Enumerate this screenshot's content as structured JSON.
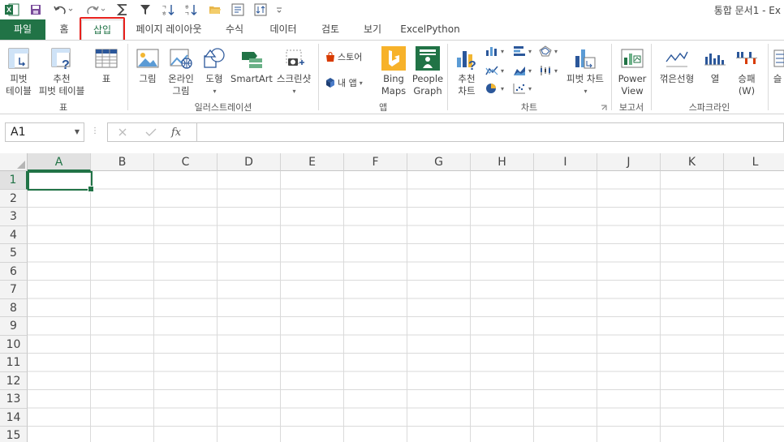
{
  "window": {
    "title": "통합 문서1 - Ex"
  },
  "tabs": [
    {
      "label": "파일"
    },
    {
      "label": "홈"
    },
    {
      "label": "삽입"
    },
    {
      "label": "페이지 레이아웃"
    },
    {
      "label": "수식"
    },
    {
      "label": "데이터"
    },
    {
      "label": "검토"
    },
    {
      "label": "보기"
    },
    {
      "label": "ExcelPython"
    }
  ],
  "ribbon": {
    "tables": {
      "pivot": "피벗\n테이블",
      "pivot_l1": "피벗",
      "pivot_l2": "테이블",
      "rec_l1": "추천",
      "rec_l2": "피벗 테이블",
      "table": "표",
      "group": "표"
    },
    "illustrations": {
      "picture": "그림",
      "online_l1": "온라인",
      "online_l2": "그림",
      "shapes": "도형",
      "smartart": "SmartArt",
      "screenshot": "스크린샷",
      "group": "일러스트레이션"
    },
    "apps": {
      "store": "스토어",
      "myapps": "내 앱",
      "bing_l1": "Bing",
      "bing_l2": "Maps",
      "people_l1": "People",
      "people_l2": "Graph",
      "group": "앱"
    },
    "charts": {
      "rec_l1": "추천",
      "rec_l2": "차트",
      "pivotchart": "피벗 차트",
      "group": "차트"
    },
    "reports": {
      "power_l1": "Power",
      "power_l2": "View",
      "group": "보고서"
    },
    "sparklines": {
      "line": "꺾은선형",
      "column": "열",
      "winloss_l1": "승패",
      "winloss_l2": "(W)",
      "group": "스파크라인"
    },
    "slicer": "슬"
  },
  "formula_bar": {
    "name_box": "A1",
    "fx": "fx",
    "value": ""
  },
  "grid": {
    "columns": [
      "A",
      "B",
      "C",
      "D",
      "E",
      "F",
      "G",
      "H",
      "I",
      "J",
      "K",
      "L"
    ],
    "rows": [
      "1",
      "2",
      "3",
      "4",
      "5",
      "6",
      "7",
      "8",
      "9",
      "10",
      "11",
      "12",
      "13",
      "14",
      "15"
    ],
    "active_cell": "A1"
  },
  "colors": {
    "excel_green": "#217346",
    "highlight_red": "#e8201c"
  }
}
